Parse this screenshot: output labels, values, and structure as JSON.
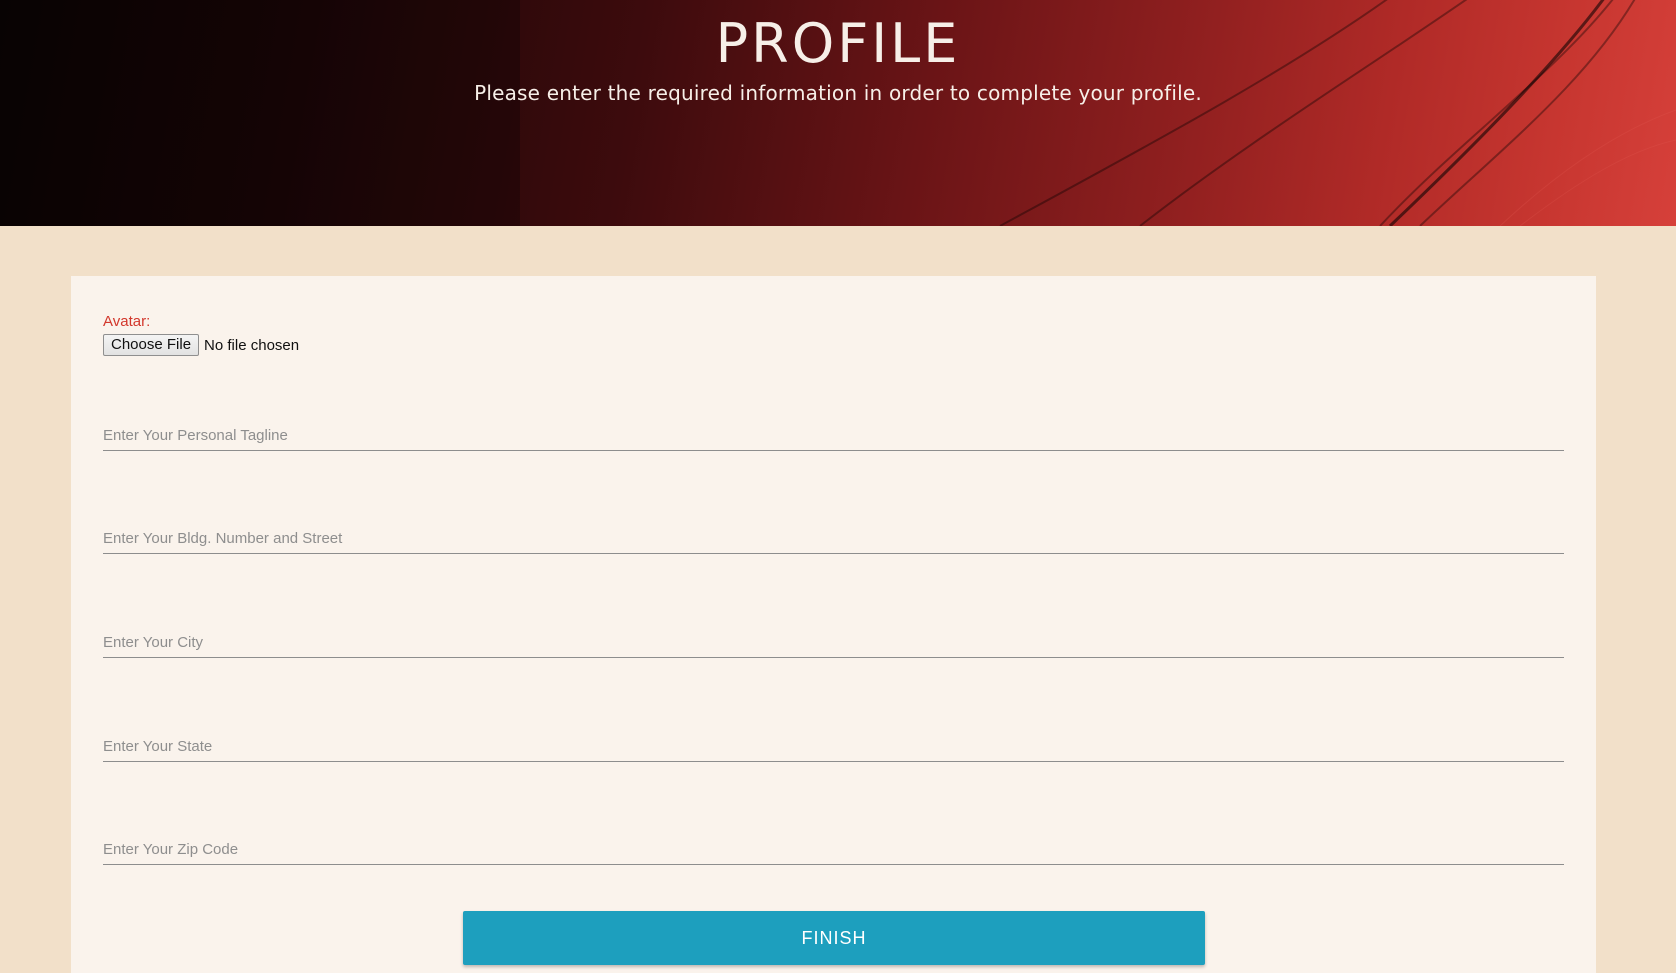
{
  "hero": {
    "title": "PROFILE",
    "subtitle": "Please enter the required information in order to complete your profile."
  },
  "form": {
    "avatar_label": "Avatar:",
    "file_button_label": "Choose File",
    "file_status": "No file chosen",
    "fields": [
      {
        "name": "tagline-input",
        "placeholder": "Enter Your Personal Tagline",
        "value": ""
      },
      {
        "name": "street-input",
        "placeholder": "Enter Your Bldg. Number and Street",
        "value": ""
      },
      {
        "name": "city-input",
        "placeholder": "Enter Your City",
        "value": ""
      },
      {
        "name": "state-input",
        "placeholder": "Enter Your State",
        "value": ""
      },
      {
        "name": "zip-code-input",
        "placeholder": "Enter Your Zip Code",
        "value": ""
      }
    ],
    "finish_label": "FINISH"
  },
  "colors": {
    "page_background": "#f2e0c9",
    "card_background": "#faf3ec",
    "label_red": "#d2372c",
    "button_accent": "#1d9fbe"
  }
}
